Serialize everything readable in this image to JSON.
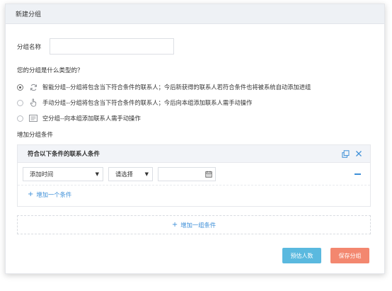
{
  "dialog": {
    "title": "新建分组"
  },
  "form": {
    "name_label": "分组名称",
    "name_value": "",
    "type_question": "您的分组是什么类型的？",
    "options": [
      {
        "label": "智能分组--分组将包含当下符合条件的联系人；今后新获得的联系人若符合条件也将被系统自动添加进组",
        "icon": "refresh-icon",
        "selected": true
      },
      {
        "label": "手动分组--分组将包含当下符合条件的联系人；今后向本组添加联系人需手动操作",
        "icon": "hand-pointer-icon",
        "selected": false
      },
      {
        "label": "空分组--向本组添加联系人需手动操作",
        "icon": "list-card-icon",
        "selected": false
      }
    ]
  },
  "conditions": {
    "section_title": "增加分组条件",
    "box_title": "符合以下条件的联系人条件",
    "row": {
      "field_value": "添加时间",
      "operator_value": "请选择",
      "date_value": ""
    },
    "add_condition_label": "增加一个条件",
    "add_group_label": "增加一组条件"
  },
  "buttons": {
    "estimate_label": "预估人数",
    "save_label": "保存分组"
  },
  "colors": {
    "accent_blue": "#3d8fd8",
    "estimate_button": "#5ab9df",
    "save_button": "#f3876f",
    "header_bg": "#eef1f5"
  }
}
